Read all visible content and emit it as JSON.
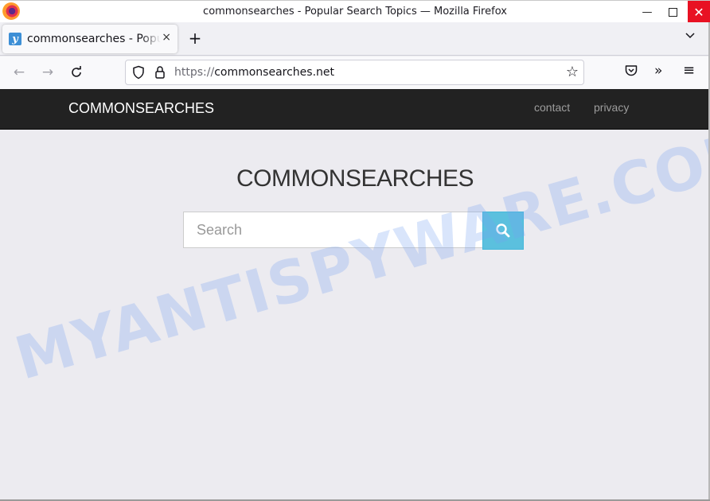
{
  "window": {
    "title": "commonsearches - Popular Search Topics — Mozilla Firefox",
    "minimize_glyph": "—",
    "close_glyph": "✕"
  },
  "tabs": [
    {
      "favicon_letter": "y",
      "title": "commonsearches - Popular Search Topics",
      "close_glyph": "×"
    }
  ],
  "tabstrip": {
    "new_tab_glyph": "+",
    "list_tabs_glyph": "⌄"
  },
  "navbar": {
    "back_glyph": "←",
    "forward_glyph": "→",
    "reload_glyph": "↻",
    "url_protocol": "https://",
    "url_host": "commonsearches.net",
    "bookmark_glyph": "☆",
    "overflow_glyph": "»",
    "menu_glyph": "≡"
  },
  "site": {
    "brand": "COMMONSEARCHES",
    "nav_links": [
      "contact",
      "privacy"
    ],
    "hero_title": "COMMONSEARCHES",
    "search": {
      "placeholder": "Search",
      "value": ""
    },
    "colors": {
      "header_bg": "#222222",
      "search_button": "#5bc0de"
    }
  },
  "overlay": {
    "watermark": "MYANTISPYWARE.COM"
  }
}
